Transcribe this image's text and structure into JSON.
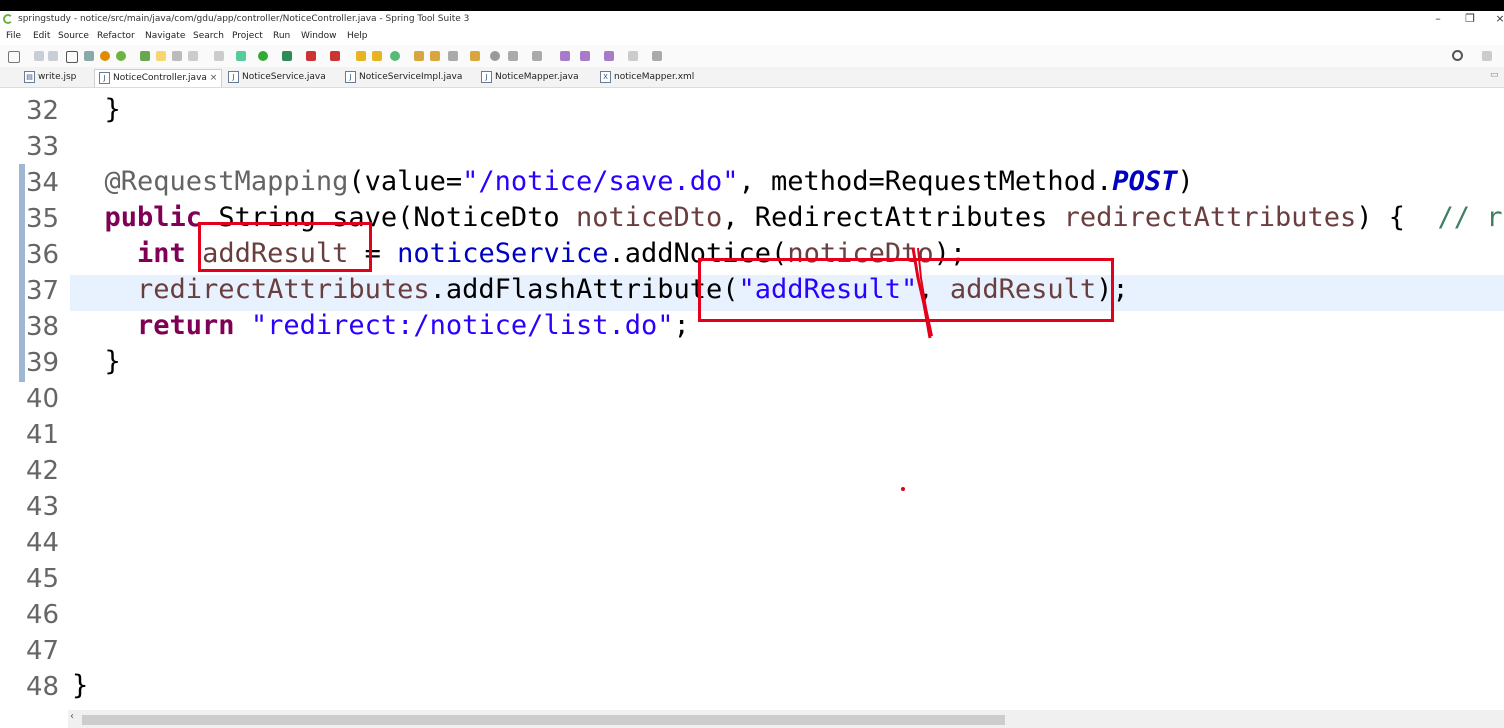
{
  "window": {
    "title": "springstudy - notice/src/main/java/com/gdu/app/controller/NoticeController.java - Spring Tool Suite 3"
  },
  "menu": [
    "File",
    "Edit",
    "Source",
    "Refactor",
    "Navigate",
    "Search",
    "Project",
    "Run",
    "Window",
    "Help"
  ],
  "tabs": [
    {
      "label": "write.jsp",
      "icon": "jsp-file-icon"
    },
    {
      "label": "NoticeController.java",
      "icon": "java-file-icon",
      "active": true,
      "close": "×"
    },
    {
      "label": "NoticeService.java",
      "icon": "java-file-icon"
    },
    {
      "label": "NoticeServiceImpl.java",
      "icon": "java-file-icon"
    },
    {
      "label": "NoticeMapper.java",
      "icon": "java-file-icon"
    },
    {
      "label": "noticeMapper.xml",
      "icon": "xml-file-icon"
    }
  ],
  "editor": {
    "current_line": 37,
    "lines": [
      {
        "n": "32",
        "code": "  }"
      },
      {
        "n": "33",
        "code": ""
      },
      {
        "n": "34",
        "code": "  @RequestMapping(value=\"/notice/save.do\", method=RequestMethod.POST)"
      },
      {
        "n": "35",
        "code": "  public String save(NoticeDto noticeDto, RedirectAttributes redirectAttributes) {  // red"
      },
      {
        "n": "36",
        "code": "    int addResult = noticeService.addNotice(noticeDto);"
      },
      {
        "n": "37",
        "code": "    redirectAttributes.addFlashAttribute(\"addResult\", addResult);"
      },
      {
        "n": "38",
        "code": "    return \"redirect:/notice/list.do\";"
      },
      {
        "n": "39",
        "code": "  }"
      },
      {
        "n": "40",
        "code": ""
      },
      {
        "n": "41",
        "code": ""
      },
      {
        "n": "42",
        "code": ""
      },
      {
        "n": "43",
        "code": ""
      },
      {
        "n": "44",
        "code": ""
      },
      {
        "n": "45",
        "code": ""
      },
      {
        "n": "46",
        "code": ""
      },
      {
        "n": "47",
        "code": ""
      },
      {
        "n": "48",
        "code": "}"
      }
    ]
  },
  "colors": {
    "keyword": "#7f0055",
    "string": "#2a00ff",
    "field": "#0000c0",
    "comment": "#3f7f5f",
    "annotation_box": "#e2001a",
    "current_line_bg": "#e8f2fe"
  }
}
